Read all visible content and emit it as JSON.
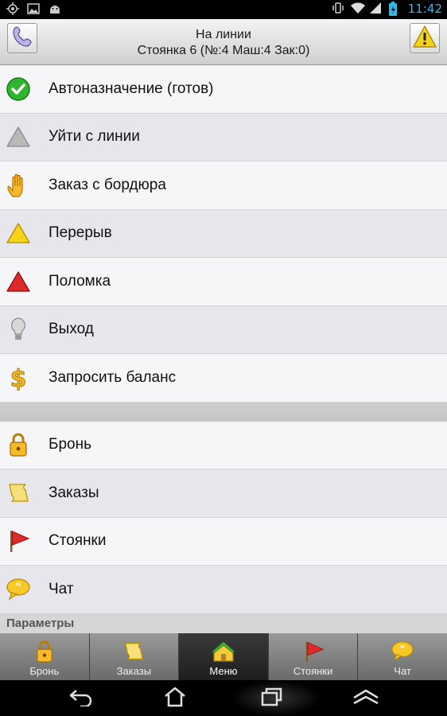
{
  "status_bar": {
    "time": "11:42",
    "icons": [
      "location-icon",
      "image-icon",
      "android-icon",
      "vibrate-icon",
      "wifi-icon",
      "signal-icon",
      "battery-icon"
    ]
  },
  "header": {
    "line1": "На линии",
    "line2": "Стоянка 6 (№:4 Маш:4 Зак:0)",
    "left_icon": "phone-icon",
    "right_icon": "warning-icon"
  },
  "menu_primary": [
    {
      "label": "Автоназначение (готов)",
      "icon": "checkmark-icon"
    },
    {
      "label": "Уйти с линии",
      "icon": "gray-triangle-icon"
    },
    {
      "label": "Заказ с бордюра",
      "icon": "hand-icon"
    },
    {
      "label": "Перерыв",
      "icon": "yellow-triangle-icon"
    },
    {
      "label": "Поломка",
      "icon": "red-triangle-icon"
    },
    {
      "label": "Выход",
      "icon": "lightbulb-icon"
    },
    {
      "label": "Запросить баланс",
      "icon": "dollar-icon"
    }
  ],
  "menu_secondary": [
    {
      "label": "Бронь",
      "icon": "lock-icon"
    },
    {
      "label": "Заказы",
      "icon": "scroll-icon"
    },
    {
      "label": "Стоянки",
      "icon": "flag-icon"
    },
    {
      "label": "Чат",
      "icon": "chat-icon"
    }
  ],
  "section_label": "Параметры",
  "tabs": [
    {
      "label": "Бронь",
      "icon": "lock-icon",
      "active": false
    },
    {
      "label": "Заказы",
      "icon": "scroll-icon",
      "active": false
    },
    {
      "label": "Меню",
      "icon": "home-icon",
      "active": true
    },
    {
      "label": "Стоянки",
      "icon": "flag-icon",
      "active": false
    },
    {
      "label": "Чат",
      "icon": "chat-icon",
      "active": false
    }
  ],
  "nav": [
    "back-icon",
    "home-icon",
    "recents-icon",
    "menu-icon"
  ],
  "colors": {
    "clock": "#33b5e5",
    "active_tab": "#1e1e1e",
    "row_light": "#f6f6f8",
    "row_dark": "#e6e6ec"
  }
}
